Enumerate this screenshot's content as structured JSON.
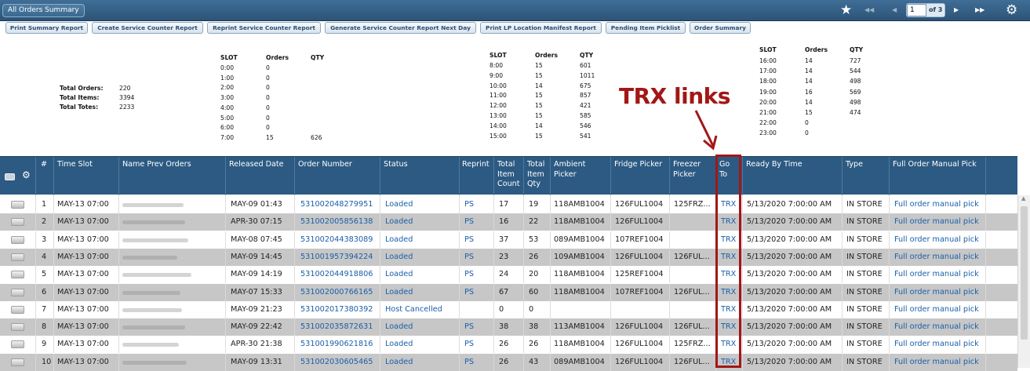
{
  "window": {
    "title": "All Orders Summary"
  },
  "pager": {
    "first": "◀◀",
    "prev": "◀",
    "page": "1",
    "of": "of 3",
    "next": "▶",
    "last": "▶▶"
  },
  "toolbar": [
    "Print Summary Report",
    "Create Service Counter Report",
    "Reprint Service Counter Report",
    "Generate Service Counter Report Next Day",
    "Print LP Location Manifest Report",
    "Pending Item Picklist",
    "Order Summary"
  ],
  "totals": {
    "orders_label": "Total Orders:",
    "orders": "220",
    "items_label": "Total Items:",
    "items": "3394",
    "totes_label": "Total Totes:",
    "totes": "2233"
  },
  "slot_headers": {
    "slot": "SLOT",
    "orders": "Orders",
    "qty": "QTY"
  },
  "slots1": [
    {
      "slot": "0:00",
      "orders": "0",
      "qty": ""
    },
    {
      "slot": "1:00",
      "orders": "0",
      "qty": ""
    },
    {
      "slot": "2:00",
      "orders": "0",
      "qty": ""
    },
    {
      "slot": "3:00",
      "orders": "0",
      "qty": ""
    },
    {
      "slot": "4:00",
      "orders": "0",
      "qty": ""
    },
    {
      "slot": "5:00",
      "orders": "0",
      "qty": ""
    },
    {
      "slot": "6:00",
      "orders": "0",
      "qty": ""
    },
    {
      "slot": "7:00",
      "orders": "15",
      "qty": "626"
    }
  ],
  "slots2": [
    {
      "slot": "8:00",
      "orders": "15",
      "qty": "601"
    },
    {
      "slot": "9:00",
      "orders": "15",
      "qty": "1011"
    },
    {
      "slot": "10:00",
      "orders": "14",
      "qty": "675"
    },
    {
      "slot": "11:00",
      "orders": "15",
      "qty": "857"
    },
    {
      "slot": "12:00",
      "orders": "15",
      "qty": "421"
    },
    {
      "slot": "13:00",
      "orders": "15",
      "qty": "585"
    },
    {
      "slot": "14:00",
      "orders": "14",
      "qty": "546"
    },
    {
      "slot": "15:00",
      "orders": "15",
      "qty": "541"
    }
  ],
  "slots3": [
    {
      "slot": "16:00",
      "orders": "14",
      "qty": "727"
    },
    {
      "slot": "17:00",
      "orders": "14",
      "qty": "544"
    },
    {
      "slot": "18:00",
      "orders": "14",
      "qty": "498"
    },
    {
      "slot": "19:00",
      "orders": "16",
      "qty": "569"
    },
    {
      "slot": "20:00",
      "orders": "14",
      "qty": "498"
    },
    {
      "slot": "21:00",
      "orders": "15",
      "qty": "474"
    },
    {
      "slot": "22:00",
      "orders": "0",
      "qty": ""
    },
    {
      "slot": "23:00",
      "orders": "0",
      "qty": ""
    }
  ],
  "columns": {
    "num": "#",
    "timeslot": "Time Slot",
    "name": "Name Prev Orders",
    "released": "Released Date",
    "order": "Order Number",
    "status": "Status",
    "reprint": "Reprint",
    "count_l1": "Total",
    "count_l2": "Item",
    "count_l3": "Count",
    "qty_l1": "Total",
    "qty_l2": "Item",
    "qty_l3": "Qty",
    "ambient_l1": "Ambient",
    "ambient_l2": "Picker",
    "fridge": "Fridge Picker",
    "freezer_l1": "Freezer",
    "freezer_l2": "Picker",
    "goto_l1": "Go",
    "goto_l2": "To",
    "ready": "Ready By Time",
    "type": "Type",
    "manual": "Full Order Manual Pick"
  },
  "rows": [
    {
      "num": "1",
      "timeslot": "MAY-13 07:00",
      "released": "MAY-09 01:43",
      "order": "531002048279951",
      "status": "Loaded",
      "reprint": "PS",
      "count": "17",
      "qty": "19",
      "ambient": "118AMB1004",
      "fridge": "126FUL1004",
      "freezer": "125FRZ...",
      "goto": "TRX",
      "ready": "5/13/2020 7:00:00 AM",
      "type": "IN STORE",
      "manual": "Full order manual pick"
    },
    {
      "num": "2",
      "timeslot": "MAY-13 07:00",
      "released": "APR-30 07:15",
      "order": "531002005856138",
      "status": "Loaded",
      "reprint": "PS",
      "count": "16",
      "qty": "22",
      "ambient": "118AMB1004",
      "fridge": "126FUL1004",
      "freezer": "",
      "goto": "TRX",
      "ready": "5/13/2020 7:00:00 AM",
      "type": "IN STORE",
      "manual": "Full order manual pick"
    },
    {
      "num": "3",
      "timeslot": "MAY-13 07:00",
      "released": "MAY-08 07:45",
      "order": "531002044383089",
      "status": "Loaded",
      "reprint": "PS",
      "count": "37",
      "qty": "53",
      "ambient": "089AMB1004",
      "fridge": "107REF1004",
      "freezer": "",
      "goto": "TRX",
      "ready": "5/13/2020 7:00:00 AM",
      "type": "IN STORE",
      "manual": "Full order manual pick"
    },
    {
      "num": "4",
      "timeslot": "MAY-13 07:00",
      "released": "MAY-09 14:45",
      "order": "531001957394224",
      "status": "Loaded",
      "reprint": "PS",
      "count": "23",
      "qty": "26",
      "ambient": "109AMB1004",
      "fridge": "126FUL1004",
      "freezer": "126FUL...",
      "goto": "TRX",
      "ready": "5/13/2020 7:00:00 AM",
      "type": "IN STORE",
      "manual": "Full order manual pick"
    },
    {
      "num": "5",
      "timeslot": "MAY-13 07:00",
      "released": "MAY-09 14:19",
      "order": "531002044918806",
      "status": "Loaded",
      "reprint": "PS",
      "count": "24",
      "qty": "20",
      "ambient": "118AMB1004",
      "fridge": "125REF1004",
      "freezer": "",
      "goto": "TRX",
      "ready": "5/13/2020 7:00:00 AM",
      "type": "IN STORE",
      "manual": "Full order manual pick"
    },
    {
      "num": "6",
      "timeslot": "MAY-13 07:00",
      "released": "MAY-07 15:33",
      "order": "531002000766165",
      "status": "Loaded",
      "reprint": "PS",
      "count": "67",
      "qty": "60",
      "ambient": "118AMB1004",
      "fridge": "107REF1004",
      "freezer": "126FUL...",
      "goto": "TRX",
      "ready": "5/13/2020 7:00:00 AM",
      "type": "IN STORE",
      "manual": "Full order manual pick"
    },
    {
      "num": "7",
      "timeslot": "MAY-13 07:00",
      "released": "MAY-09 21:23",
      "order": "531002017380392",
      "status": "Host Cancelled",
      "reprint": "",
      "count": "0",
      "qty": "0",
      "ambient": "",
      "fridge": "",
      "freezer": "",
      "goto": "TRX",
      "ready": "5/13/2020 7:00:00 AM",
      "type": "IN STORE",
      "manual": "Full order manual pick"
    },
    {
      "num": "8",
      "timeslot": "MAY-13 07:00",
      "released": "MAY-09 22:42",
      "order": "531002035872631",
      "status": "Loaded",
      "reprint": "PS",
      "count": "38",
      "qty": "38",
      "ambient": "113AMB1004",
      "fridge": "126FUL1004",
      "freezer": "126FUL...",
      "goto": "TRX",
      "ready": "5/13/2020 7:00:00 AM",
      "type": "IN STORE",
      "manual": "Full order manual pick"
    },
    {
      "num": "9",
      "timeslot": "MAY-13 07:00",
      "released": "APR-30 21:38",
      "order": "531001990621816",
      "status": "Loaded",
      "reprint": "PS",
      "count": "26",
      "qty": "26",
      "ambient": "118AMB1004",
      "fridge": "126FUL1004",
      "freezer": "125FRZ...",
      "goto": "TRX",
      "ready": "5/13/2020 7:00:00 AM",
      "type": "IN STORE",
      "manual": "Full order manual pick"
    },
    {
      "num": "10",
      "timeslot": "MAY-13 07:00",
      "released": "MAY-09 13:31",
      "order": "531002030605465",
      "status": "Loaded",
      "reprint": "PS",
      "count": "26",
      "qty": "43",
      "ambient": "089AMB1004",
      "fridge": "126FUL1004",
      "freezer": "126FUL...",
      "goto": "TRX",
      "ready": "5/13/2020 7:00:00 AM",
      "type": "IN STORE",
      "manual": "Full order manual pick"
    }
  ],
  "annotation": {
    "text": "TRX links",
    "color": "#a31717"
  }
}
